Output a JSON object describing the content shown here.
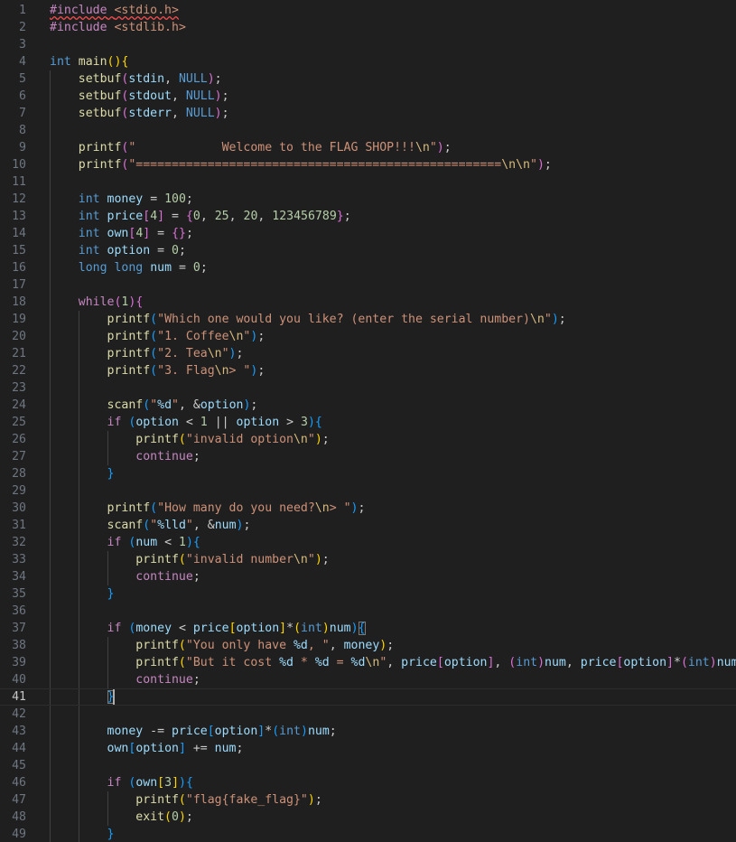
{
  "editor": {
    "language": "c",
    "current_line": 41,
    "colors": {
      "background": "#1f1f1f",
      "keyword": "#569cd6",
      "control": "#c586c0",
      "function": "#dcdcaa",
      "string": "#ce9178",
      "number": "#b5cea8",
      "variable": "#9cdcfe",
      "plain": "#cccccc",
      "escape": "#d7ba7d",
      "bracket1": "#ffd700",
      "bracket2": "#da70d6",
      "bracket3": "#179fff",
      "line_number": "#6e7681",
      "error_squiggle": "#f14c4c"
    },
    "lines": [
      {
        "n": "1",
        "code": "#include <stdio.h>"
      },
      {
        "n": "2",
        "code": "#include <stdlib.h>"
      },
      {
        "n": "3",
        "code": ""
      },
      {
        "n": "4",
        "code": "int main(){"
      },
      {
        "n": "5",
        "code": "    setbuf(stdin, NULL);"
      },
      {
        "n": "6",
        "code": "    setbuf(stdout, NULL);"
      },
      {
        "n": "7",
        "code": "    setbuf(stderr, NULL);"
      },
      {
        "n": "8",
        "code": ""
      },
      {
        "n": "9",
        "code": "    printf(\"            Welcome to the FLAG SHOP!!!\\n\");"
      },
      {
        "n": "10",
        "code": "    printf(\"===================================================\\n\\n\");"
      },
      {
        "n": "11",
        "code": ""
      },
      {
        "n": "12",
        "code": "    int money = 100;"
      },
      {
        "n": "13",
        "code": "    int price[4] = {0, 25, 20, 123456789};"
      },
      {
        "n": "14",
        "code": "    int own[4] = {};"
      },
      {
        "n": "15",
        "code": "    int option = 0;"
      },
      {
        "n": "16",
        "code": "    long long num = 0;"
      },
      {
        "n": "17",
        "code": ""
      },
      {
        "n": "18",
        "code": "    while(1){"
      },
      {
        "n": "19",
        "code": "        printf(\"Which one would you like? (enter the serial number)\\n\");"
      },
      {
        "n": "20",
        "code": "        printf(\"1. Coffee\\n\");"
      },
      {
        "n": "21",
        "code": "        printf(\"2. Tea\\n\");"
      },
      {
        "n": "22",
        "code": "        printf(\"3. Flag\\n> \");"
      },
      {
        "n": "23",
        "code": ""
      },
      {
        "n": "24",
        "code": "        scanf(\"%d\", &option);"
      },
      {
        "n": "25",
        "code": "        if (option < 1 || option > 3){"
      },
      {
        "n": "26",
        "code": "            printf(\"invalid option\\n\");"
      },
      {
        "n": "27",
        "code": "            continue;"
      },
      {
        "n": "28",
        "code": "        }"
      },
      {
        "n": "29",
        "code": ""
      },
      {
        "n": "30",
        "code": "        printf(\"How many do you need?\\n> \");"
      },
      {
        "n": "31",
        "code": "        scanf(\"%lld\", &num);"
      },
      {
        "n": "32",
        "code": "        if (num < 1){"
      },
      {
        "n": "33",
        "code": "            printf(\"invalid number\\n\");"
      },
      {
        "n": "34",
        "code": "            continue;"
      },
      {
        "n": "35",
        "code": "        }"
      },
      {
        "n": "36",
        "code": ""
      },
      {
        "n": "37",
        "code": "        if (money < price[option]*(int)num){"
      },
      {
        "n": "38",
        "code": "            printf(\"You only have %d, \", money);"
      },
      {
        "n": "39",
        "code": "            printf(\"But it cost %d * %d = %d\\n\", price[option], (int)num, price[option]*(int)num);"
      },
      {
        "n": "40",
        "code": "            continue;"
      },
      {
        "n": "41",
        "code": "        }"
      },
      {
        "n": "42",
        "code": ""
      },
      {
        "n": "43",
        "code": "        money -= price[option]*(int)num;"
      },
      {
        "n": "44",
        "code": "        own[option] += num;"
      },
      {
        "n": "45",
        "code": ""
      },
      {
        "n": "46",
        "code": "        if (own[3]){"
      },
      {
        "n": "47",
        "code": "            printf(\"flag{fake_flag}\");"
      },
      {
        "n": "48",
        "code": "            exit(0);"
      },
      {
        "n": "49",
        "code": "        }"
      }
    ]
  }
}
